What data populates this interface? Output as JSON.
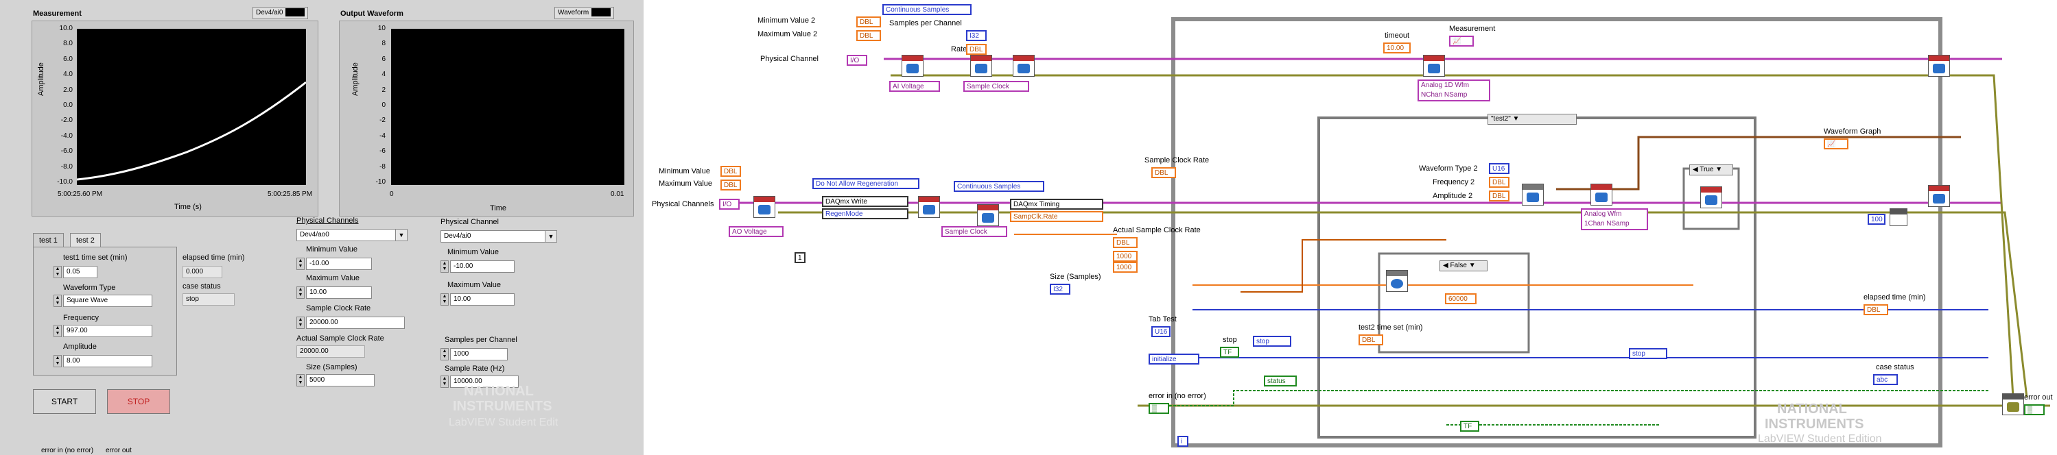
{
  "front_panel": {
    "measurement_graph": {
      "title": "Measurement",
      "legend": "Dev4/ai0",
      "y_label": "Amplitude",
      "x_label": "Time (s)",
      "y_ticks": [
        "10.0",
        "8.0",
        "6.0",
        "4.0",
        "2.0",
        "0.0",
        "-2.0",
        "-4.0",
        "-6.0",
        "-8.0",
        "-10.0"
      ],
      "x_start": "5:00:25.60 PM",
      "x_end": "5:00:25.85 PM"
    },
    "output_graph": {
      "title": "Output Waveform",
      "legend": "Waveform",
      "y_label": "Amplitude",
      "x_label": "Time",
      "y_ticks": [
        "10",
        "8",
        "6",
        "4",
        "2",
        "0",
        "-2",
        "-4",
        "-6",
        "-8",
        "-10"
      ],
      "x_start": "0",
      "x_end": "0.01"
    },
    "tabs": [
      "test 1",
      "test 2"
    ],
    "test1_time_label": "test1 time set (min)",
    "test1_time_value": "0.05",
    "waveform_type_label": "Waveform Type",
    "waveform_type_value": "Square Wave",
    "frequency_label": "Frequency",
    "frequency_value": "997.00",
    "amplitude_label": "Amplitude",
    "amplitude_value": "8.00",
    "elapsed_label": "elapsed time (min)",
    "elapsed_value": "0.000",
    "case_status_label": "case status",
    "case_status_value": "stop",
    "start_label": "START",
    "stop_label": "STOP",
    "phys_channels_label": "Physical Channels",
    "phys_channels_value": "Dev4/ao0",
    "min_label": "Minimum Value",
    "min_value": "-10.00",
    "max_label": "Maximum Value",
    "max_value": "10.00",
    "sample_clock_label": "Sample Clock Rate",
    "sample_clock_value": "20000.00",
    "actual_clock_label": "Actual Sample Clock Rate",
    "actual_clock_value": "20000.00",
    "size_label": "Size (Samples)",
    "size_value": "5000",
    "phys_channel_label": "Physical Channel",
    "phys_channel_value": "Dev4/ai0",
    "min2_label": "Minimum Value",
    "min2_value": "-10.00",
    "max2_label": "Maximum Value",
    "max2_value": "10.00",
    "samples_per_channel_label": "Samples per Channel",
    "samples_per_channel_value": "1000",
    "sample_rate_label": "Sample Rate (Hz)",
    "sample_rate_value": "10000.00",
    "ni_logo_line1": "NATIONAL",
    "ni_logo_line2": "INSTRUMENTS",
    "ni_logo_line3": "LabVIEW Student Edit",
    "bottom_left": "error in (no error)",
    "bottom_right": "error out"
  },
  "block_diagram": {
    "min2": "Minimum Value 2",
    "max2": "Maximum Value 2",
    "phys_channel": "Physical Channel",
    "continuous_top": "Continuous Samples",
    "samples_per_channel": "Samples per Channel",
    "rate": "Rate",
    "ai_voltage": "AI Voltage",
    "sample_clock_top": "Sample Clock",
    "timeout": "timeout",
    "timeout_value": "10.00",
    "measurement": "Measurement",
    "analog_1d_a": "Analog 1D Wfm",
    "analog_1d_b": "NChan NSamp",
    "sample_clock_rate": "Sample Clock Rate",
    "min_value": "Minimum Value",
    "max_value": "Maximum Value",
    "phys_channels": "Physical Channels",
    "regen": "Do Not Allow Regeneration",
    "daqmx_write": "DAQmx Write",
    "regen_mode": "RegenMode",
    "continuous_mid": "Continuous Samples",
    "daqmx_timing": "DAQmx Timing",
    "sampclk_rate": "SampClk.Rate",
    "ao_voltage": "AO Voltage",
    "sample_clock_mid": "Sample Clock",
    "actual_rate": "Actual Sample Clock Rate",
    "const_1000a": "1000",
    "const_1000b": "1000",
    "size_samples": "Size (Samples)",
    "case_test2": "\"test2\"",
    "waveform_graph": "Waveform Graph",
    "wf_type2": "Waveform Type 2",
    "freq2": "Frequency 2",
    "amp2": "Amplitude 2",
    "analog_wfm_a": "Analog Wfm",
    "analog_wfm_b": "1Chan NSamp",
    "true_case": "True",
    "false_case": "False",
    "const_60000": "60000",
    "const_100": "100",
    "test2_time": "test2 time set (min)",
    "elapsed": "elapsed time (min)",
    "tab_test": "Tab Test",
    "initialize": "initialize",
    "stop": "stop",
    "stop_enum1": "stop",
    "stop_enum2": "stop",
    "status": "status",
    "case_status": "case status",
    "error_in": "error in (no error)",
    "error_out": "error out",
    "iter_i": "i",
    "ni_logo_line1": "NATIONAL",
    "ni_logo_line2": "INSTRUMENTS",
    "ni_logo_line3": "LabVIEW Student Edition"
  }
}
